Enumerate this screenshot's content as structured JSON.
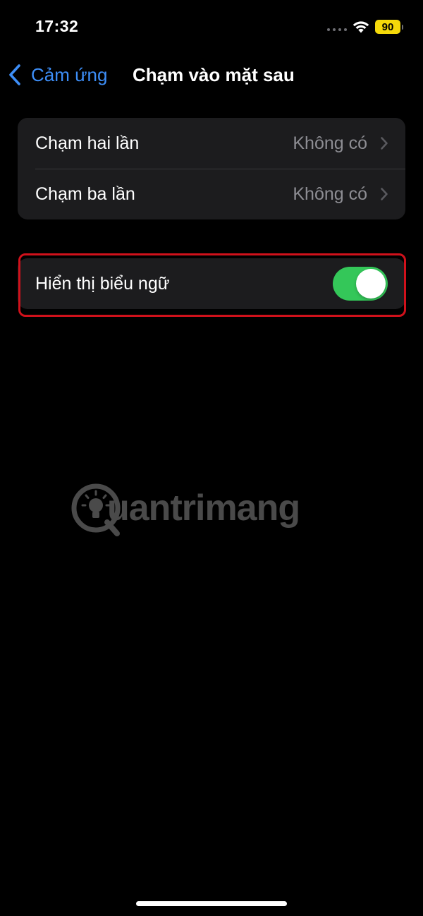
{
  "status_bar": {
    "time": "17:32",
    "battery_level": "90",
    "battery_color": "#f5d90a",
    "icons": [
      "signal-dots-icon",
      "wifi-icon",
      "battery-icon"
    ]
  },
  "nav": {
    "back_label": "Cảm ứng",
    "title": "Chạm vào mặt sau",
    "accent_color": "#3d8ef7"
  },
  "groups": [
    {
      "rows": [
        {
          "label": "Chạm hai lần",
          "value": "Không có"
        },
        {
          "label": "Chạm ba lần",
          "value": "Không có"
        }
      ]
    },
    {
      "rows": [
        {
          "label": "Hiển thị biểu ngữ",
          "toggle_on": true,
          "toggle_color": "#34c759"
        }
      ]
    }
  ],
  "annotation": {
    "highlight_color": "#d0111b"
  },
  "watermark": {
    "text": "uantrimang"
  }
}
